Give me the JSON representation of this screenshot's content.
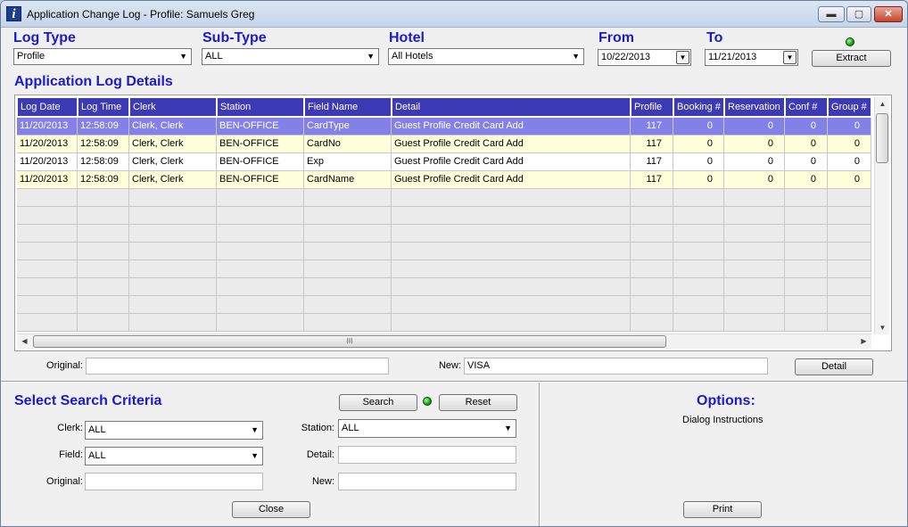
{
  "window": {
    "title": "Application Change Log - Profile:  Samuels Greg",
    "minimize_glyph": "▬",
    "maximize_glyph": "▢",
    "close_glyph": "✕"
  },
  "filters": {
    "log_type_label": "Log Type",
    "log_type_value": "Profile",
    "subtype_label": "Sub-Type",
    "subtype_value": "ALL",
    "hotel_label": "Hotel",
    "hotel_value": "All Hotels",
    "from_label": "From",
    "from_value": "10/22/2013",
    "to_label": "To",
    "to_value": "11/21/2013",
    "extract_label": "Extract"
  },
  "details": {
    "title": "Application Log Details",
    "columns": [
      "Log Date",
      "Log Time",
      "Clerk",
      "Station",
      "Field Name",
      "Detail",
      "Profile",
      "Booking #",
      "Reservation",
      "Conf #",
      "Group #"
    ],
    "rows": [
      [
        "11/20/2013",
        "12:58:09",
        "Clerk, Clerk",
        "BEN-OFFICE",
        "CardType",
        "Guest Profile Credit Card Add",
        "117",
        "0",
        "0",
        "0",
        "0"
      ],
      [
        "11/20/2013",
        "12:58:09",
        "Clerk, Clerk",
        "BEN-OFFICE",
        "CardNo",
        "Guest Profile Credit Card Add",
        "117",
        "0",
        "0",
        "0",
        "0"
      ],
      [
        "11/20/2013",
        "12:58:09",
        "Clerk, Clerk",
        "BEN-OFFICE",
        "Exp",
        "Guest Profile Credit Card Add",
        "117",
        "0",
        "0",
        "0",
        "0"
      ],
      [
        "11/20/2013",
        "12:58:09",
        "Clerk, Clerk",
        "BEN-OFFICE",
        "CardName",
        "Guest Profile Credit Card Add",
        "117",
        "0",
        "0",
        "0",
        "0"
      ]
    ],
    "hscroll_grip": "III",
    "original_label": "Original:",
    "original_value": "",
    "new_label": "New:",
    "new_value": "VISA",
    "detail_button": "Detail"
  },
  "search": {
    "title": "Select Search Criteria",
    "search_button": "Search",
    "reset_button": "Reset",
    "clerk_label": "Clerk:",
    "clerk_value": "ALL",
    "station_label": "Station:",
    "station_value": "ALL",
    "field_label": "Field:",
    "field_value": "ALL",
    "detail_label": "Detail:",
    "detail_value": "",
    "original_label": "Original:",
    "original_value": "",
    "new_label": "New:",
    "new_value": "",
    "close_button": "Close"
  },
  "options": {
    "title": "Options:",
    "instructions": "Dialog Instructions",
    "print_button": "Print"
  },
  "colors": {
    "header_bg": "#3d3ab5",
    "selected_row": "#8381e8",
    "alt_row": "#ffffd9",
    "label_blue": "#1a1ad0"
  }
}
